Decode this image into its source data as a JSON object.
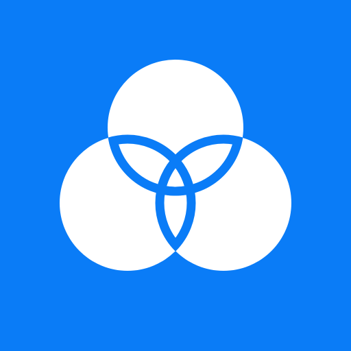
{
  "icon": {
    "name": "venn-trefoil-logo",
    "background_color": "#0a7cf7",
    "foreground_color": "#ffffff",
    "stroke_color": "#0a7cf7"
  }
}
